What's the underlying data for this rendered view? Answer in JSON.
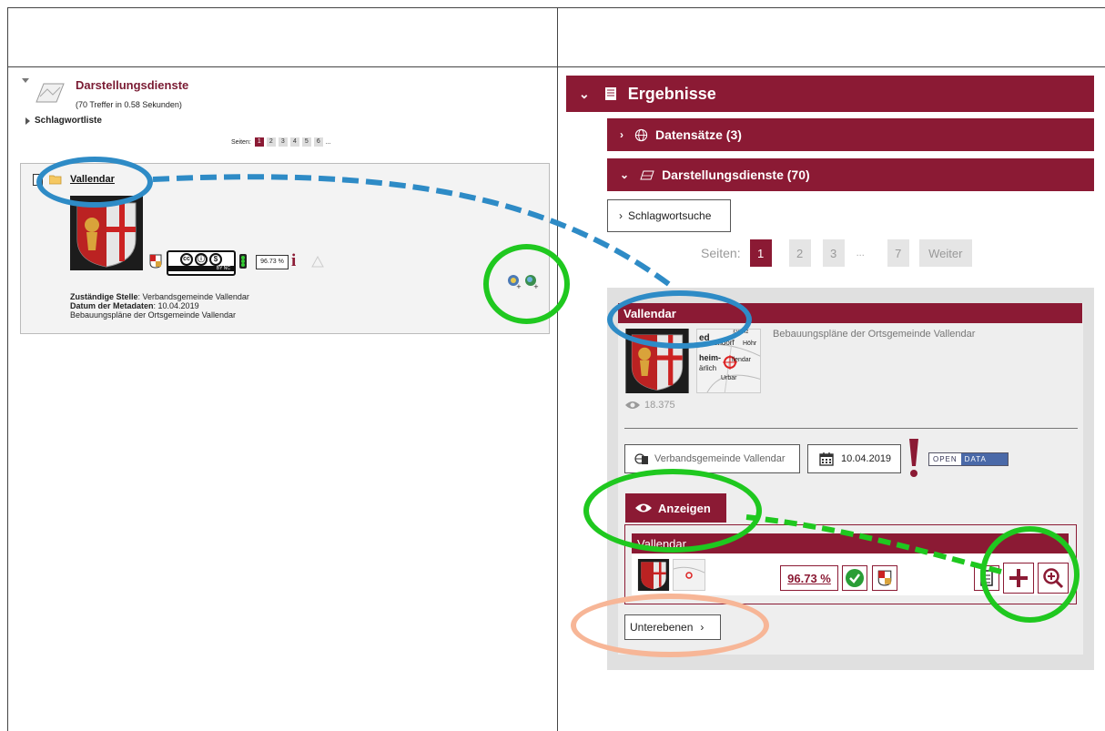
{
  "left": {
    "title": "Darstellungsdienste",
    "hits": "(70 Treffer in 0.58 Sekunden)",
    "keyword_list": "Schlagwortliste",
    "pages_label": "Seiten:",
    "pages": [
      "1",
      "2",
      "3",
      "4",
      "5",
      "6",
      "..."
    ],
    "result": {
      "name": "Vallendar",
      "cc_license": "BY NC",
      "score": "96.73 %",
      "responsible_label": "Zuständige Stelle",
      "responsible_value": ": Verbandsgemeinde Vallendar",
      "metadata_date_label": "Datum der Metadaten",
      "metadata_date_value": ": 10.04.2019",
      "description": "Bebauungspläne der Ortsgemeinde Vallendar"
    }
  },
  "right": {
    "results_title": "Ergebnisse",
    "datasets": "Datensätze (3)",
    "services": "Darstellungsdienste (70)",
    "keyword_search": "Schlagwortsuche",
    "pages_label": "Seiten:",
    "pages": [
      "1",
      "2",
      "3",
      "...",
      "7"
    ],
    "next": "Weiter",
    "card": {
      "title": "Vallendar",
      "description": "Bebauungspläne der Ortsgemeinde Vallendar",
      "views": "18.375",
      "organization": "Verbandsgemeinde Vallendar",
      "date": "10.04.2019",
      "open_data": [
        "OPEN",
        "DATA"
      ],
      "show_button": "Anzeigen",
      "layer_title": "Vallendar",
      "layer_score": "96.73 %",
      "sublayers": "Unterebenen",
      "map_labels": [
        "ed",
        "endorf",
        "heim-",
        "ärlich",
        "llendar",
        "Urbar",
        "Grenz",
        "Höhr"
      ]
    }
  },
  "colors": {
    "brand": "#8b1a34",
    "blue_annotation": "#2e8bc6",
    "green_annotation": "#1fc81f",
    "peach_annotation": "#f7b697"
  }
}
